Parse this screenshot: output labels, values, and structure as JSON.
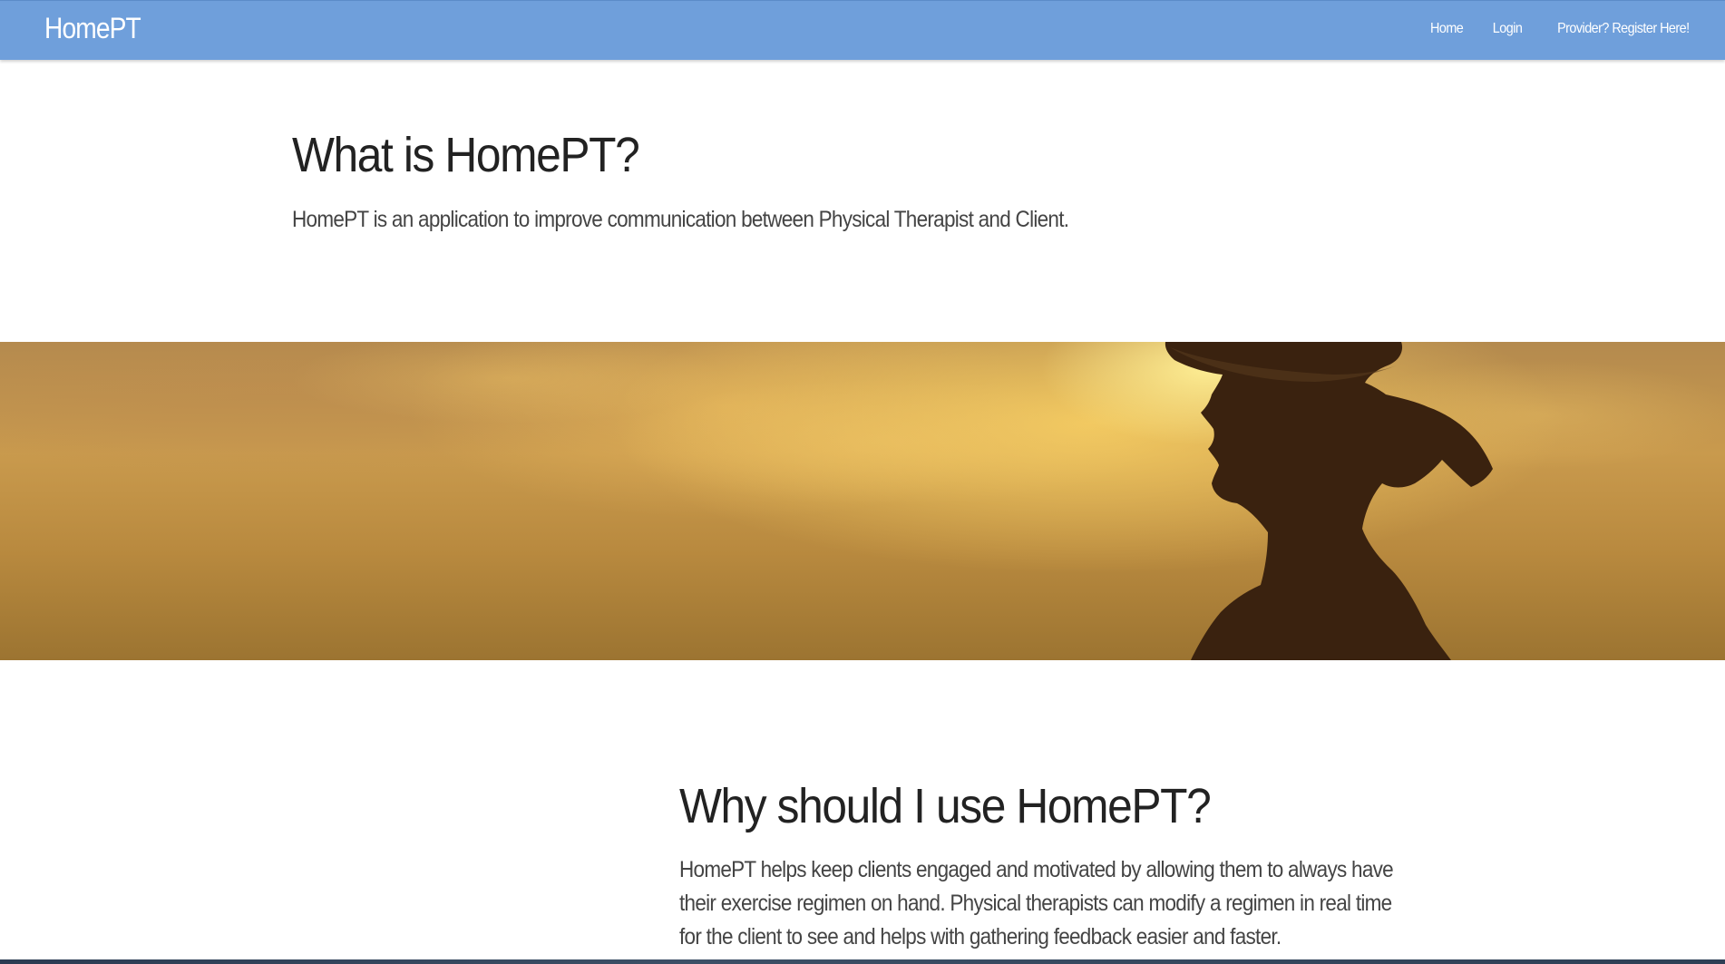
{
  "navbar": {
    "brand": "HomePT",
    "links": [
      "Home",
      "Login",
      "Provider? Register Here!"
    ],
    "color": "#6f9fdb"
  },
  "section_what": {
    "title": "What is HomePT?",
    "text": "HomePT is an application to improve communication between Physical Therapist and Client."
  },
  "banner": {
    "icon": "sunset-runner-silhouette-image"
  },
  "section_why": {
    "title": "Why should I use HomePT?",
    "text": "HomePT helps keep clients engaged and motivated by allowing them to always have their exercise regimen on hand. Physical therapists can modify a regimen in real time for the client to see and helps with gathering feedback easier and faster."
  }
}
